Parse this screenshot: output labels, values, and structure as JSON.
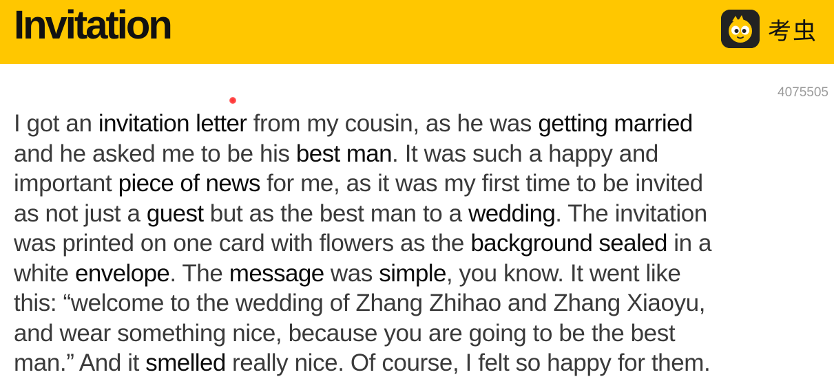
{
  "header": {
    "title": "Invitation",
    "brand_icon": "chick-mascot-icon",
    "brand_name": "考虫",
    "accent_color": "#ffc700"
  },
  "document": {
    "id": "4075505",
    "lines": [
      [
        {
          "text": "I got an ",
          "kw": false
        },
        {
          "text": "invitation letter",
          "kw": true
        },
        {
          "text": " from my cousin, as he was ",
          "kw": false
        },
        {
          "text": "getting married",
          "kw": true
        }
      ],
      [
        {
          "text": "and he asked me to be his ",
          "kw": false
        },
        {
          "text": "best man",
          "kw": true
        },
        {
          "text": ". It was such a happy and",
          "kw": false
        }
      ],
      [
        {
          "text": "important ",
          "kw": false
        },
        {
          "text": "piece of news",
          "kw": true
        },
        {
          "text": " for me, as it was my first time to be invited",
          "kw": false
        }
      ],
      [
        {
          "text": "as not just a ",
          "kw": false
        },
        {
          "text": "guest",
          "kw": true
        },
        {
          "text": " but as the best man to a ",
          "kw": false
        },
        {
          "text": "wedding",
          "kw": true
        },
        {
          "text": ". The invitation",
          "kw": false
        }
      ],
      [
        {
          "text": "was printed on one card with flowers as the ",
          "kw": false
        },
        {
          "text": "background sealed",
          "kw": true
        },
        {
          "text": " in a",
          "kw": false
        }
      ],
      [
        {
          "text": "white ",
          "kw": false
        },
        {
          "text": "envelope",
          "kw": true
        },
        {
          "text": ". The ",
          "kw": false
        },
        {
          "text": "message",
          "kw": true
        },
        {
          "text": " was ",
          "kw": false
        },
        {
          "text": "simple",
          "kw": true
        },
        {
          "text": ", you know. It went like",
          "kw": false
        }
      ],
      [
        {
          "text": "this: “welcome to the wedding of Zhang Zhihao and Zhang Xiaoyu,",
          "kw": false
        }
      ],
      [
        {
          "text": "and wear something nice, because you are going to be the best",
          "kw": false
        }
      ],
      [
        {
          "text": "man.” And it ",
          "kw": false
        },
        {
          "text": "smelled",
          "kw": true
        },
        {
          "text": " really nice. Of course, I felt so happy for them.",
          "kw": false
        }
      ]
    ]
  }
}
